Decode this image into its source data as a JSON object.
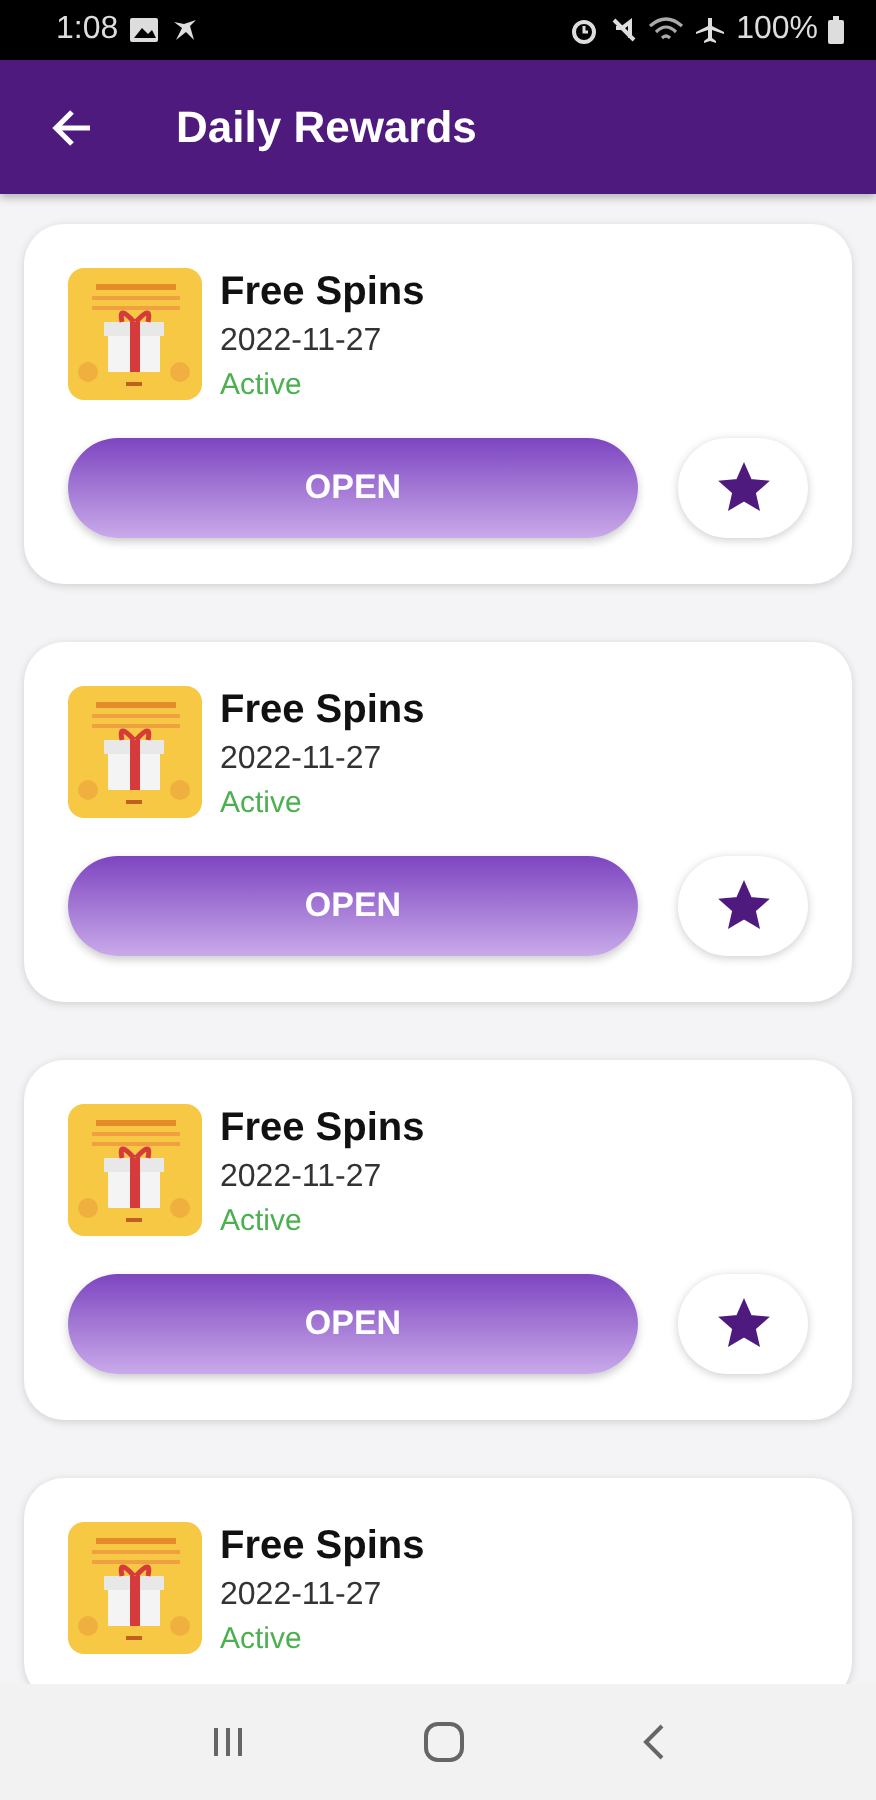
{
  "status_bar": {
    "time": "1:08",
    "battery": "100%"
  },
  "app_bar": {
    "title": "Daily Rewards"
  },
  "rewards": [
    {
      "kind": "picture",
      "title": "Free Spins",
      "date": "2022-11-27",
      "status": "Active",
      "button": "OPEN",
      "favorite": true
    },
    {
      "kind": "picture",
      "title": "Free Spins",
      "date": "2022-11-27",
      "status": "Active",
      "button": "OPEN",
      "favorite": true
    },
    {
      "kind": "picture",
      "title": "Free Spins",
      "date": "2022-11-27",
      "status": "Active",
      "button": "OPEN",
      "favorite": true
    },
    {
      "kind": "picture",
      "title": "Free Spins",
      "date": "2022-11-27",
      "status": "Active"
    }
  ]
}
